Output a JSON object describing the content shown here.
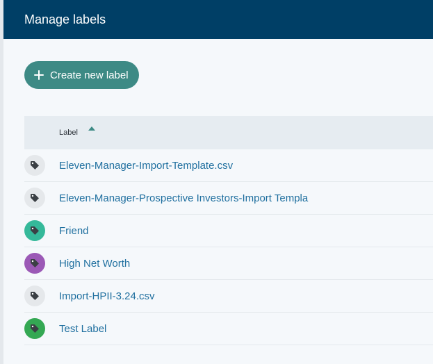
{
  "header": {
    "title": "Manage labels"
  },
  "toolbar": {
    "create_label": "Create new label"
  },
  "table": {
    "column_label": "Label",
    "sort_direction": "ascending",
    "rows": [
      {
        "name": "Eleven-Manager-Import-Template.csv",
        "color": "#e5e8eb"
      },
      {
        "name": "Eleven-Manager-Prospective Investors-Import Templa",
        "color": "#e5e8eb"
      },
      {
        "name": "Friend",
        "color": "#35b99a"
      },
      {
        "name": "High Net Worth",
        "color": "#9b59b6"
      },
      {
        "name": "Import-HPII-3.24.csv",
        "color": "#e5e8eb"
      },
      {
        "name": "Test Label",
        "color": "#34a853"
      }
    ]
  },
  "colors": {
    "header_bg": "#003f66",
    "button_bg": "#3d8a85",
    "link": "#1f6f9f",
    "tag_icon": "#3a3f44"
  },
  "icons": {
    "row_icon": "tag-icon",
    "sort": "caret-up-icon",
    "button": "plus-icon"
  }
}
